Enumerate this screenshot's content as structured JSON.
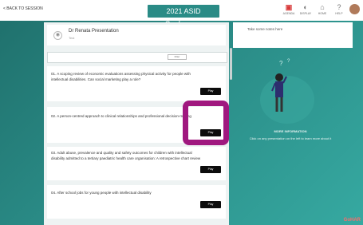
{
  "header": {
    "back_link": "< BACK TO SESSION",
    "title": "2021 ASID Conference",
    "icons": [
      {
        "name": "agenda-logo",
        "symbol": "⬛",
        "label": "AGENDA"
      },
      {
        "name": "toggle-icon",
        "symbol": "◐",
        "label": "DISPLAY"
      },
      {
        "name": "home-icon",
        "symbol": "⌂",
        "label": "HOME"
      },
      {
        "name": "help-icon",
        "symbol": "?",
        "label": "HELP"
      }
    ]
  },
  "presenter": {
    "name": "Dr Renata Presentation",
    "sub": "Test"
  },
  "search": {
    "field_text": "Filter"
  },
  "questions": [
    {
      "text": "01. A scoping review of economic evaluations assessing physical activity for people with intellectual disabilities. Can social marketing play a role?",
      "button": "Play"
    },
    {
      "text": "02. A person-centred approach to clinical relationships and professional decision-making",
      "button": "Play"
    },
    {
      "text": "03. Adult abuse, prevalence and quality and safety outcomes for children with intellectual disability admitted to a tertiary paediatric health care organisation: A retrospective chart review",
      "button": "Play"
    },
    {
      "text": "04. After school jobs for young people with intellectual disability",
      "button": "Play"
    }
  ],
  "right_panel": {
    "note": "Take some notes here",
    "info_title": "MORE INFORMATION",
    "info_sub": "Click on any presentation on the left to learn more about it"
  },
  "corner_logo": "GoHAR",
  "colors": {
    "highlight": "#a0187f",
    "teal": "#2a8b86"
  }
}
